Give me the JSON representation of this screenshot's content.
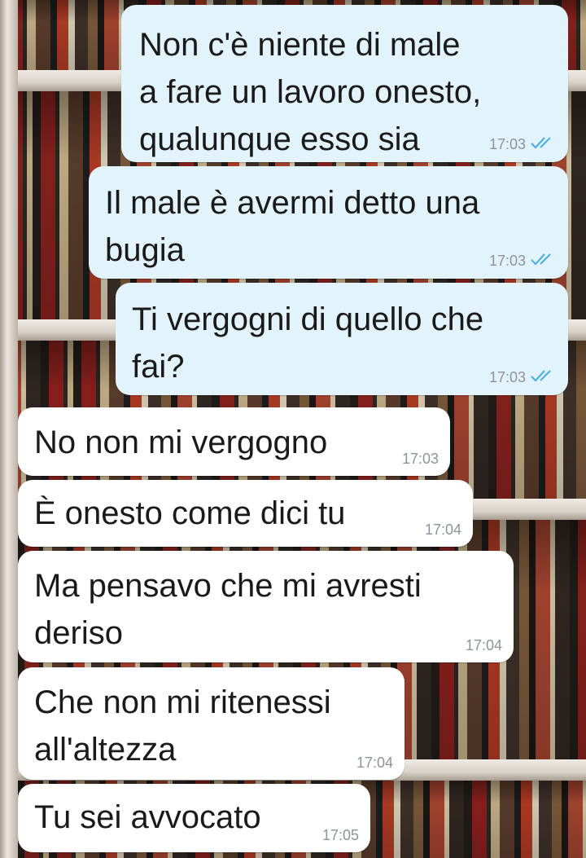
{
  "messages": [
    {
      "direction": "outgoing",
      "text": "Non c'è niente di male\na fare un lavoro onesto,\nqualunque esso sia",
      "time": "17:03",
      "status_icon": "double-check-read-icon"
    },
    {
      "direction": "outgoing",
      "text": "Il male è avermi detto una\nbugia",
      "time": "17:03",
      "status_icon": "double-check-read-icon"
    },
    {
      "direction": "outgoing",
      "text": "Ti vergogni di quello che\nfai?",
      "time": "17:03",
      "status_icon": "double-check-read-icon"
    },
    {
      "direction": "incoming",
      "text": "No non mi vergogno",
      "time": "17:03"
    },
    {
      "direction": "incoming",
      "text": "È onesto come dici tu",
      "time": "17:04"
    },
    {
      "direction": "incoming",
      "text": "Ma pensavo che mi avresti\nderiso",
      "time": "17:04"
    },
    {
      "direction": "incoming",
      "text": "Che non mi ritenessi\nall'altezza",
      "time": "17:04"
    },
    {
      "direction": "incoming",
      "text": "Tu sei avvocato",
      "time": "17:05"
    }
  ],
  "colors": {
    "outgoing_bubble": "#e3f3fb",
    "incoming_bubble": "#ffffff",
    "read_ticks": "#4fb1e3",
    "timestamp": "#8c9499"
  },
  "wallpaper": "bookshelf"
}
